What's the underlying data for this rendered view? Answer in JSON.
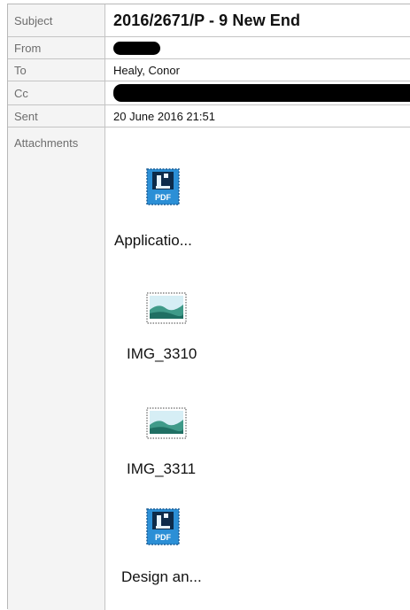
{
  "header": {
    "subject": {
      "label": "Subject",
      "value": "2016/2671/P - 9 New End"
    },
    "from": {
      "label": "From",
      "value": ""
    },
    "to": {
      "label": "To",
      "value": "Healy, Conor"
    },
    "cc": {
      "label": "Cc",
      "value": ""
    },
    "sent": {
      "label": "Sent",
      "value": "20 June 2016 21:51"
    }
  },
  "attachments": {
    "label": "Attachments",
    "items": [
      {
        "name": "Applicatio...",
        "icon": "pdf-file-icon"
      },
      {
        "name": "IMG_3310",
        "icon": "image-file-icon"
      },
      {
        "name": "IMG_3311",
        "icon": "image-file-icon"
      },
      {
        "name": "Design an...",
        "icon": "pdf-file-icon"
      }
    ]
  },
  "colors": {
    "label_bg": "#f4f4f4",
    "label_text": "#6d6d6d",
    "pdf_blue": "#2b8fd6",
    "redaction": "#000000"
  }
}
